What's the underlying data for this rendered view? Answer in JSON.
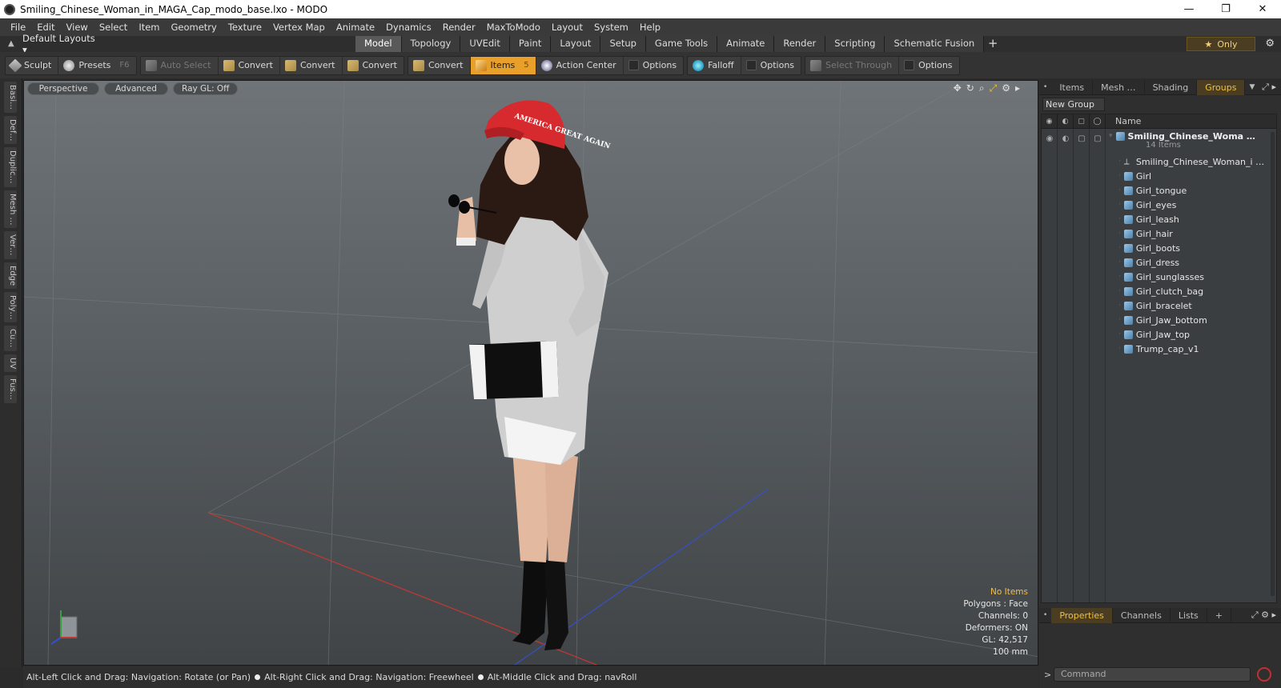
{
  "window": {
    "title": "Smiling_Chinese_Woman_in_MAGA_Cap_modo_base.lxo - MODO",
    "minimize": "—",
    "maximize": "❐",
    "close": "✕"
  },
  "menu": [
    "File",
    "Edit",
    "View",
    "Select",
    "Item",
    "Geometry",
    "Texture",
    "Vertex Map",
    "Animate",
    "Dynamics",
    "Render",
    "MaxToModo",
    "Layout",
    "System",
    "Help"
  ],
  "layout": {
    "dropdown": "Default Layouts ▾",
    "tabs": [
      "Model",
      "Topology",
      "UVEdit",
      "Paint",
      "Layout",
      "Setup",
      "Game Tools",
      "Animate",
      "Render",
      "Scripting",
      "Schematic Fusion"
    ],
    "active_tab": "Model",
    "add_tab": "+",
    "only_label": "Only",
    "only_icon": "★"
  },
  "toolbar": {
    "sculpt": "Sculpt",
    "presets": "Presets",
    "presets_key": "F6",
    "auto_select": "Auto Select",
    "convert1": "Convert",
    "convert2": "Convert",
    "convert3": "Convert",
    "convert4": "Convert",
    "items": "Items",
    "items_key": "5",
    "action_center": "Action Center",
    "options1": "Options",
    "falloff": "Falloff",
    "options2": "Options",
    "select_through": "Select Through",
    "options3": "Options"
  },
  "left_tabs": [
    "Basi…",
    "Def…",
    "Duplic…",
    "Mesh …",
    "Ver…",
    "Edge",
    "Poly…",
    "Cu…",
    "UV",
    "Fus…"
  ],
  "viewport": {
    "perspective": "Perspective",
    "advanced": "Advanced",
    "raygl": "Ray GL: Off",
    "info": {
      "no_items": "No Items",
      "polygons": "Polygons : Face",
      "channels": "Channels: 0",
      "deformers": "Deformers: ON",
      "gl": "GL: 42,517",
      "scale": "100 mm"
    },
    "cap_text": "AMERICA GREAT AGAIN",
    "colors": {
      "cap": "#d62a2f",
      "hair": "#2b1a14",
      "dress": "#d9d9d9",
      "boots": "#0d0d0d",
      "skin": "#e8c1a8",
      "bag": "#111111"
    }
  },
  "status": {
    "hint1": "Alt-Left Click and Drag: Navigation: Rotate (or Pan)",
    "hint2": "Alt-Right Click and Drag: Navigation: Freewheel",
    "hint3": "Alt-Middle Click and Drag: navRoll"
  },
  "right_panel": {
    "tabs": [
      "Items",
      "Mesh …",
      "Shading",
      "Groups"
    ],
    "active_tab": "Groups",
    "new_group": "New Group",
    "column_name": "Name",
    "root": "Smiling_Chinese_Woma …",
    "root_sub": "14 Items",
    "items": [
      "Smiling_Chinese_Woman_i …",
      "Girl",
      "Girl_tongue",
      "Girl_eyes",
      "Girl_leash",
      "Girl_hair",
      "Girl_boots",
      "Girl_dress",
      "Girl_sunglasses",
      "Girl_clutch_bag",
      "Girl_bracelet",
      "Girl_Jaw_bottom",
      "Girl_Jaw_top",
      "Trump_cap_v1"
    ],
    "bottom_tabs": [
      "Properties",
      "Channels",
      "Lists"
    ],
    "bottom_active": "Properties",
    "bottom_add": "+",
    "command_placeholder": "Command",
    "prompt": ">"
  }
}
